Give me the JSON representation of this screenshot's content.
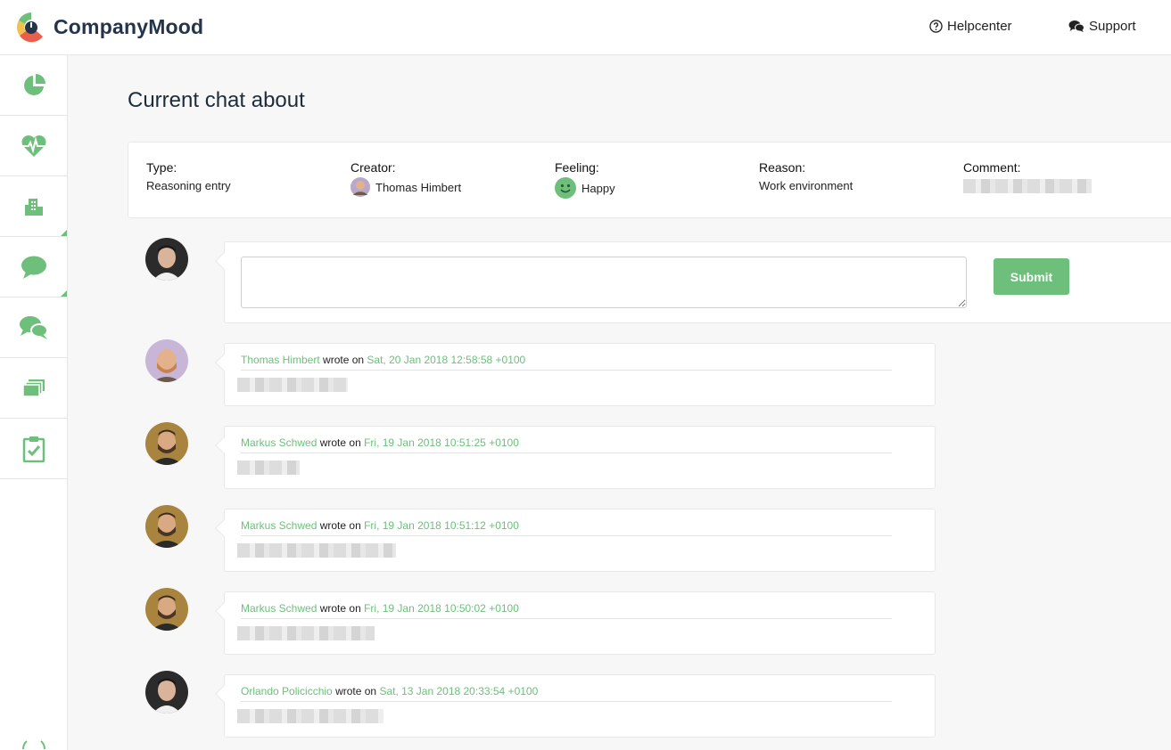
{
  "app": {
    "name": "CompanyMood"
  },
  "header": {
    "helpcenter": "Helpcenter",
    "support": "Support"
  },
  "sidebar": {
    "items": [
      "dashboard",
      "mood",
      "company",
      "chat",
      "conversations",
      "entries",
      "surveys"
    ]
  },
  "page": {
    "title": "Current chat about"
  },
  "info": {
    "type_label": "Type:",
    "type_value": "Reasoning entry",
    "creator_label": "Creator:",
    "creator_value": "Thomas Himbert",
    "feeling_label": "Feeling:",
    "feeling_value": "Happy",
    "reason_label": "Reason:",
    "reason_value": "Work environment",
    "comment_label": "Comment:"
  },
  "compose": {
    "submit_label": "Submit"
  },
  "messages": [
    {
      "author": "Thomas Himbert",
      "wrote_on": "wrote on",
      "date": "Sat, 20 Jan 2018 12:58:58 +0100"
    },
    {
      "author": "Markus Schwed",
      "wrote_on": "wrote on",
      "date": "Fri, 19 Jan 2018 10:51:25 +0100"
    },
    {
      "author": "Markus Schwed",
      "wrote_on": "wrote on",
      "date": "Fri, 19 Jan 2018 10:51:12 +0100"
    },
    {
      "author": "Markus Schwed",
      "wrote_on": "wrote on",
      "date": "Fri, 19 Jan 2018 10:50:02 +0100"
    },
    {
      "author": "Orlando Policicchio",
      "wrote_on": "wrote on",
      "date": "Sat, 13 Jan 2018 20:33:54 +0100"
    }
  ],
  "colors": {
    "accent": "#6dbf7b",
    "title": "#1e2b3a"
  }
}
